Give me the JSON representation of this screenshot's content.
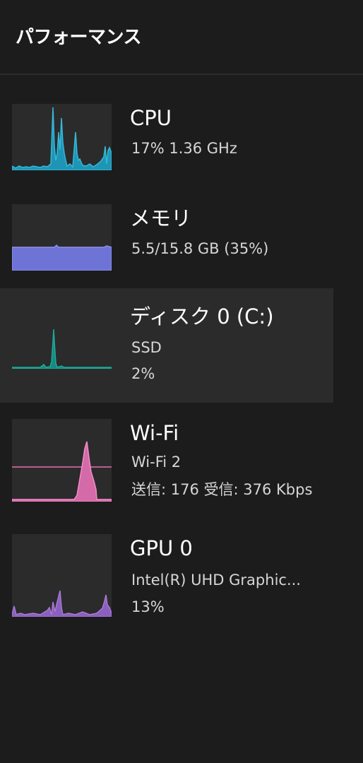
{
  "header": {
    "title": "パフォーマンス"
  },
  "colors": {
    "background": "#1c1c1c",
    "graph_bg": "#2b2b2b",
    "selected_bg": "#2b2b2b",
    "cpu": "#33b9d8",
    "memory": "#6e73d6",
    "disk": "#1fa99a",
    "wifi": "#e86fb6",
    "gpu": "#a779d6"
  },
  "items": [
    {
      "name": "CPU",
      "line1": "17%  1.36 GHz",
      "line2": "",
      "selected": false
    },
    {
      "name": "メモリ",
      "line1": "5.5/15.8 GB (35%)",
      "line2": "",
      "selected": false
    },
    {
      "name": "ディスク 0 (C:)",
      "line1": "SSD",
      "line2": "2%",
      "selected": true
    },
    {
      "name": "Wi-Fi",
      "line1": "Wi-Fi 2",
      "line2": "送信: 176  受信: 376 Kbps",
      "selected": false
    },
    {
      "name": "GPU 0",
      "line1": "Intel(R) UHD Graphic...",
      "line2": "13%",
      "selected": false
    }
  ]
}
